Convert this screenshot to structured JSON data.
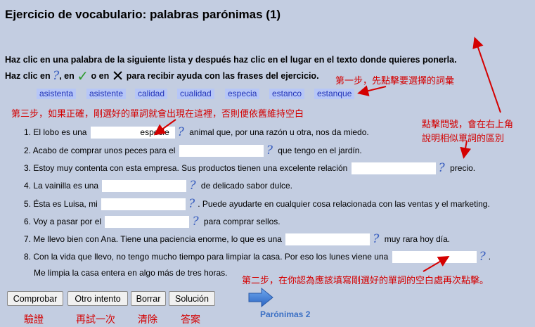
{
  "title": "Ejercicio de vocabulario: palabras parónimas (1)",
  "instructions": {
    "line1": "Haz clic en una palabra de la siguiente lista y después haz clic en el lugar en el texto donde quieres ponerla.",
    "line2_a": "Haz clic en",
    "line2_b": ", en",
    "line2_c": "o en",
    "line2_d": "para recibir ayuda con las frases del ejercicio.",
    "help_glyph": "?",
    "check_glyph": "✓",
    "cross_glyph": "✕"
  },
  "words": [
    "asistenta",
    "asistente",
    "calidad",
    "cualidad",
    "especia",
    "estanco",
    "estanque"
  ],
  "questions": [
    {
      "num": "1.",
      "before": "El lobo es una",
      "gap": "especie",
      "after": "animal que, por una razón u otra, nos da miedo."
    },
    {
      "num": "2.",
      "before": "Acabo de comprar unos peces para el",
      "gap": "",
      "after": "que tengo en el jardín."
    },
    {
      "num": "3.",
      "before": "Estoy muy contenta con esta empresa. Sus productos tienen una excelente relación",
      "gap": "",
      "after": "precio."
    },
    {
      "num": "4.",
      "before": "La vainilla es una",
      "gap": "",
      "after": "de delicado sabor dulce."
    },
    {
      "num": "5.",
      "before": "Ésta es Luisa, mi",
      "gap": "",
      "after": ". Puede ayudarte en cualquier cosa relacionada con las ventas y el marketing."
    },
    {
      "num": "6.",
      "before": "Voy a pasar por el",
      "gap": "",
      "after": "para comprar sellos."
    },
    {
      "num": "7.",
      "before": "Me llevo bien con Ana. Tiene una paciencia enorme, lo que es una",
      "gap": "",
      "after": "muy rara hoy día."
    },
    {
      "num": "8.",
      "before": "Con la vida que llevo, no tengo mucho tiempo para limpiar la casa. Por eso los lunes viene una",
      "gap": "",
      "after": ".",
      "line2": "Me limpia la casa entera en algo más de tres horas."
    }
  ],
  "buttons": {
    "check": "Comprobar",
    "retry": "Otro intento",
    "clear": "Borrar",
    "solution": "Solución"
  },
  "button_labels": {
    "check": "驗證",
    "retry": "再試一次",
    "clear": "清除",
    "solution": "答案"
  },
  "next_link": "Parónimas 2",
  "annotations": {
    "step1": "第一步，先點擊要選擇的詞彙",
    "step2": "第二步，在你認為應該填寫剛選好的單詞的空白處再次點擊。",
    "step3": "第三步，如果正確，剛選好的單詞就會出現在這裡，否則便依舊維持空白",
    "help_line1": "點擊問號，會在右上角",
    "help_line2": "說明相似單詞的區別"
  },
  "colors": {
    "background": "#c3cde1",
    "word_bg": "#b6c6f7",
    "word_text": "#2234b8",
    "annotation": "#d40000",
    "help_icon": "#3a5fbf"
  }
}
